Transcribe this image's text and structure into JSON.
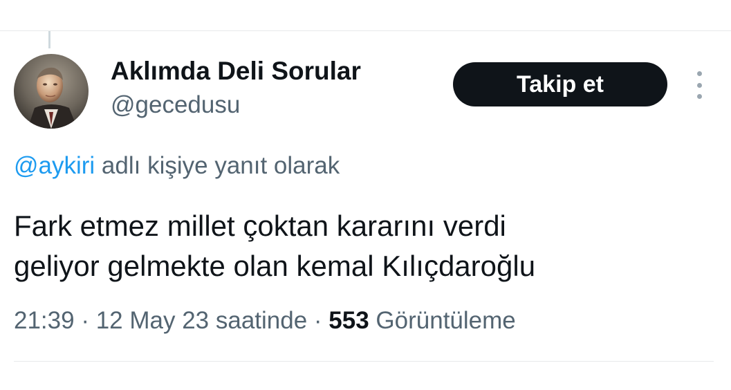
{
  "tweet": {
    "author": {
      "display_name": "Aklımda Deli Sorular",
      "handle": "@gecedusu",
      "avatar_icon": "portrait-avatar"
    },
    "follow_button_label": "Takip et",
    "more_icon": "more-vertical-icon",
    "reply_context": {
      "mention": "@aykiri",
      "suffix": " adlı kişiye yanıt olarak"
    },
    "text_lines": [
      "Fark etmez millet çoktan kararını verdi",
      "geliyor gelmekte olan kemal Kılıçdaroğlu"
    ],
    "meta": {
      "time": "21:39",
      "separator1": " · ",
      "date": "12 May 23 saatinde",
      "separator2": " · ",
      "views_count": "553",
      "views_label": " Görüntüleme"
    }
  },
  "colors": {
    "text_primary": "#0f1419",
    "text_secondary": "#536471",
    "link": "#1d9bf0",
    "button_bg": "#0f1419",
    "divider": "#e7e9ea"
  }
}
